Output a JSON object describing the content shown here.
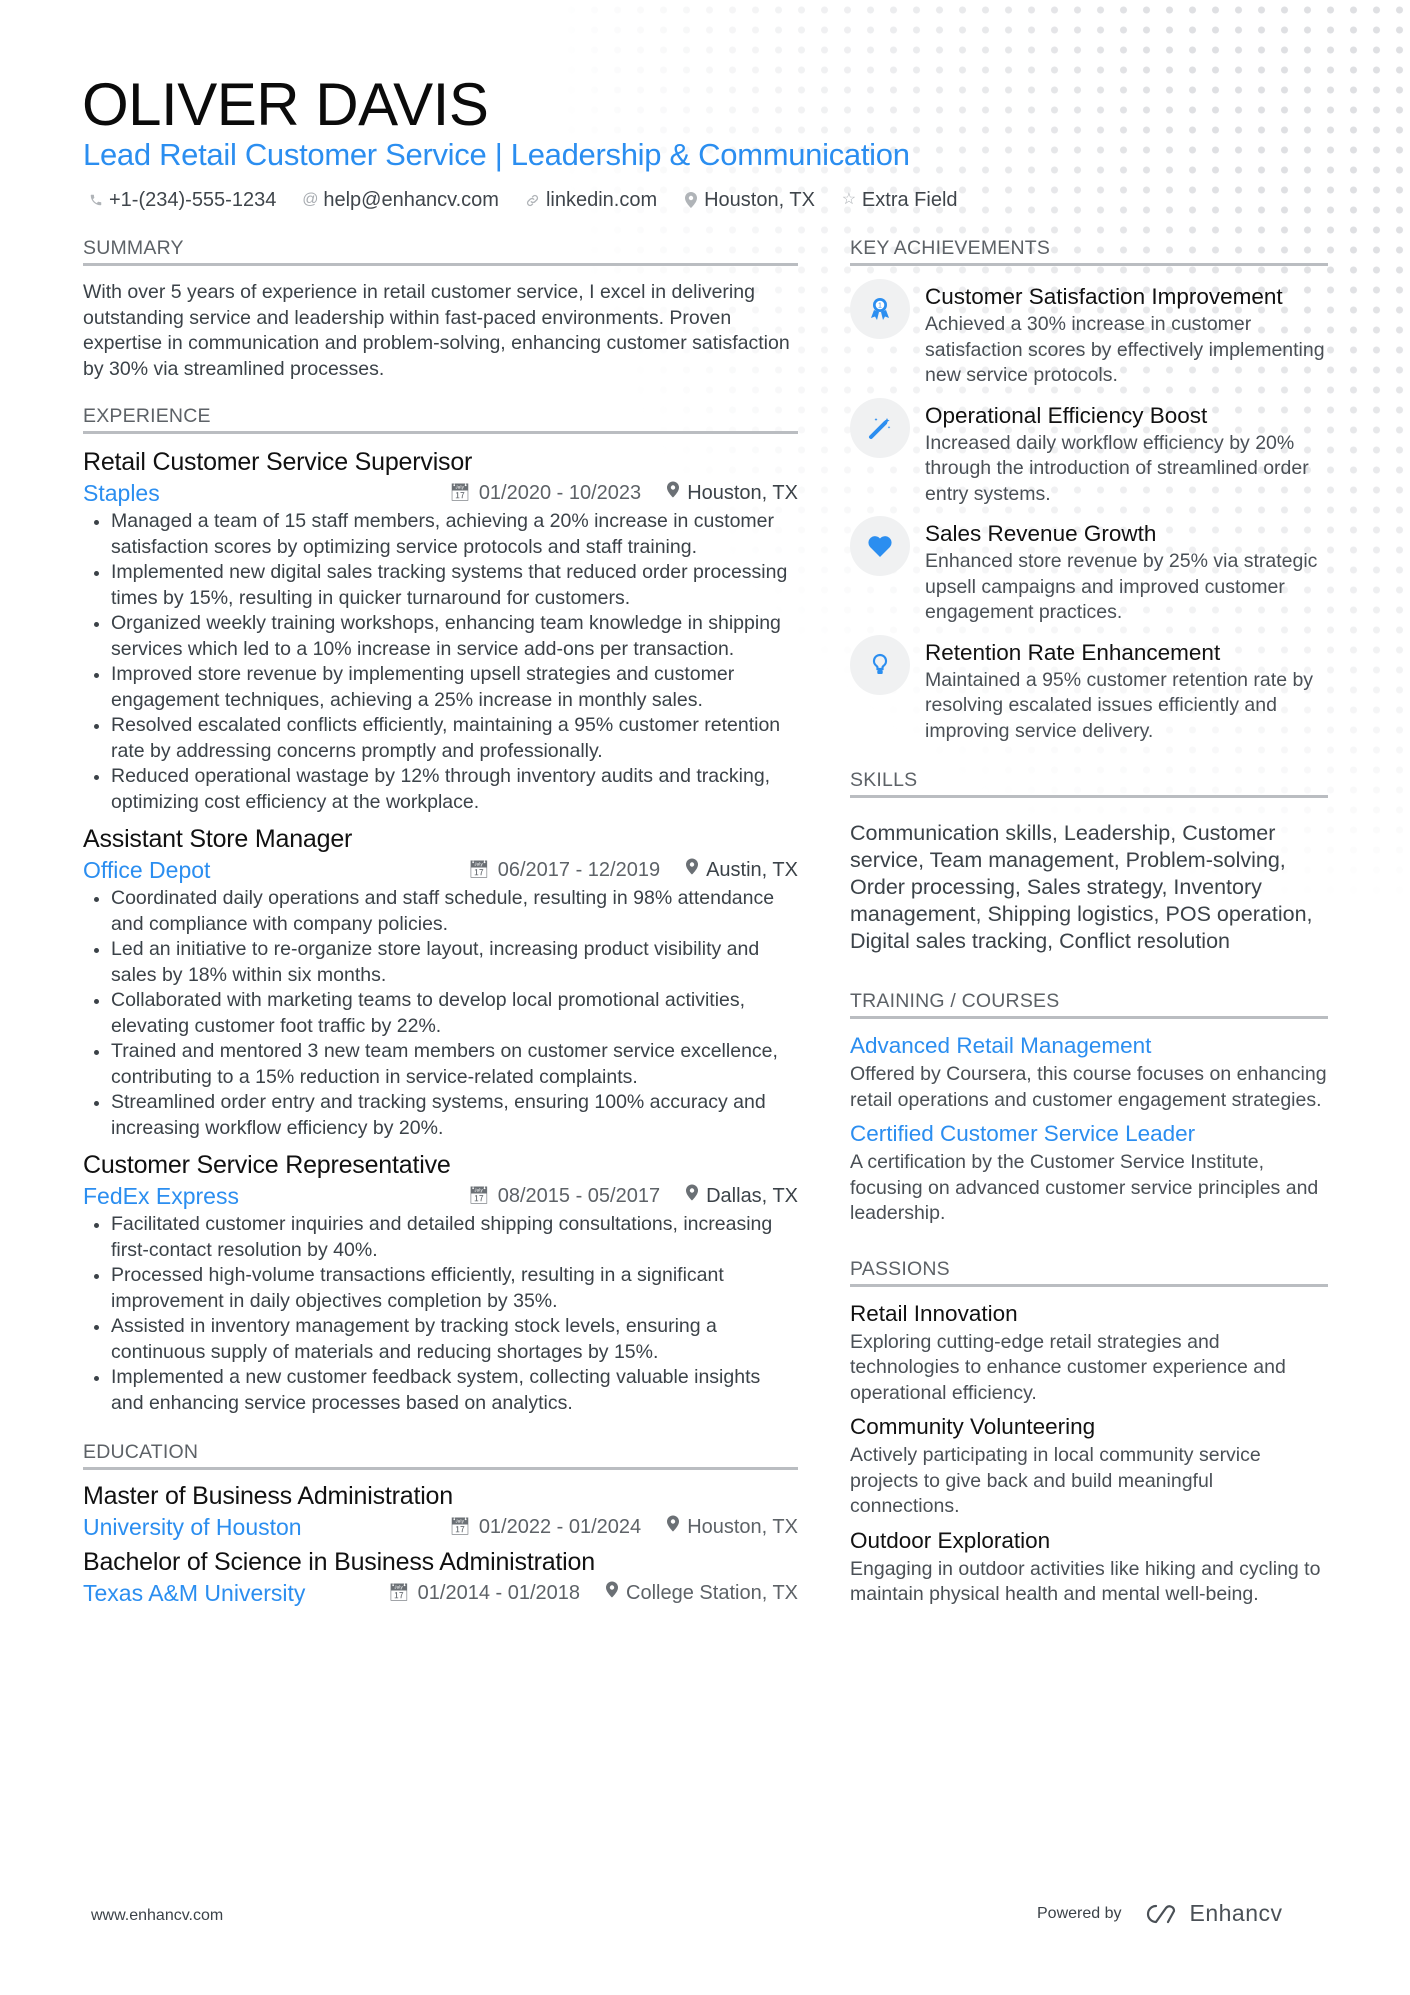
{
  "header": {
    "name": "OLIVER DAVIS",
    "headline": "Lead Retail Customer Service | Leadership & Communication",
    "contacts": [
      {
        "icon": "phone-icon",
        "text": "+1-(234)-555-1234"
      },
      {
        "icon": "at-icon",
        "text": "help@enhancv.com"
      },
      {
        "icon": "link-icon",
        "text": "linkedin.com"
      },
      {
        "icon": "map-pin-icon",
        "text": "Houston, TX"
      },
      {
        "icon": "star-icon",
        "text": "Extra Field"
      }
    ]
  },
  "summary": {
    "heading": "SUMMARY",
    "text": "With over 5 years of experience in retail customer service, I excel in delivering outstanding service and leadership within fast-paced environments. Proven expertise in communication and problem-solving, enhancing customer satisfaction by 30% via streamlined processes."
  },
  "experience": {
    "heading": "EXPERIENCE",
    "jobs": [
      {
        "title": "Retail Customer Service Supervisor",
        "company": "Staples",
        "dates": "01/2020 - 10/2023",
        "location": "Houston, TX",
        "bullets": [
          "Managed a team of 15 staff members, achieving a 20% increase in customer satisfaction scores by optimizing service protocols and staff training.",
          "Implemented new digital sales tracking systems that reduced order processing times by 15%, resulting in quicker turnaround for customers.",
          "Organized weekly training workshops, enhancing team knowledge in shipping services which led to a 10% increase in service add-ons per transaction.",
          "Improved store revenue by implementing upsell strategies and customer engagement techniques, achieving a 25% increase in monthly sales.",
          "Resolved escalated conflicts efficiently, maintaining a 95% customer retention rate by addressing concerns promptly and professionally.",
          "Reduced operational wastage by 12% through inventory audits and tracking, optimizing cost efficiency at the workplace."
        ]
      },
      {
        "title": "Assistant Store Manager",
        "company": "Office Depot",
        "dates": "06/2017 - 12/2019",
        "location": "Austin, TX",
        "bullets": [
          "Coordinated daily operations and staff schedule, resulting in 98% attendance and compliance with company policies.",
          "Led an initiative to re-organize store layout, increasing product visibility and sales by 18% within six months.",
          "Collaborated with marketing teams to develop local promotional activities, elevating customer foot traffic by 22%.",
          "Trained and mentored 3 new team members on customer service excellence, contributing to a 15% reduction in service-related complaints.",
          "Streamlined order entry and tracking systems, ensuring 100% accuracy and increasing workflow efficiency by 20%."
        ]
      },
      {
        "title": "Customer Service Representative",
        "company": "FedEx Express",
        "dates": "08/2015 - 05/2017",
        "location": "Dallas, TX",
        "bullets": [
          "Facilitated customer inquiries and detailed shipping consultations, increasing first-contact resolution by 40%.",
          "Processed high-volume transactions efficiently, resulting in a significant improvement in daily objectives completion by 35%.",
          "Assisted in inventory management by tracking stock levels, ensuring a continuous supply of materials and reducing shortages by 15%.",
          "Implemented a new customer feedback system, collecting valuable insights and enhancing service processes based on analytics."
        ]
      }
    ]
  },
  "education": {
    "heading": "EDUCATION",
    "items": [
      {
        "degree": "Master of Business Administration",
        "school": "University of Houston",
        "dates": "01/2022 - 01/2024",
        "location": "Houston, TX"
      },
      {
        "degree": "Bachelor of Science in Business Administration",
        "school": "Texas A&M University",
        "dates": "01/2014 - 01/2018",
        "location": "College Station, TX"
      }
    ]
  },
  "achievements": {
    "heading": "KEY ACHIEVEMENTS",
    "items": [
      {
        "icon": "award-ribbon-icon",
        "title": "Customer Satisfaction Improvement",
        "desc": "Achieved a 30% increase in customer satisfaction scores by effectively implementing new service protocols."
      },
      {
        "icon": "magic-wand-icon",
        "title": "Operational Efficiency Boost",
        "desc": "Increased daily workflow efficiency by 20% through the introduction of streamlined order entry systems."
      },
      {
        "icon": "heart-icon",
        "title": "Sales Revenue Growth",
        "desc": "Enhanced store revenue by 25% via strategic upsell campaigns and improved customer engagement practices."
      },
      {
        "icon": "lightbulb-icon",
        "title": "Retention Rate Enhancement",
        "desc": "Maintained a 95% customer retention rate by resolving escalated issues efficiently and improving service delivery."
      }
    ]
  },
  "skills": {
    "heading": "SKILLS",
    "text": "Communication skills, Leadership, Customer service, Team management, Problem-solving, Order processing, Sales strategy, Inventory management, Shipping logistics, POS operation, Digital sales tracking, Conflict resolution"
  },
  "training": {
    "heading": "TRAINING / COURSES",
    "items": [
      {
        "title": "Advanced Retail Management",
        "desc": "Offered by Coursera, this course focuses on enhancing retail operations and customer engagement strategies."
      },
      {
        "title": "Certified Customer Service Leader",
        "desc": "A certification by the Customer Service Institute, focusing on advanced customer service principles and leadership."
      }
    ]
  },
  "passions": {
    "heading": "PASSIONS",
    "items": [
      {
        "title": "Retail Innovation",
        "desc": "Exploring cutting-edge retail strategies and technologies to enhance customer experience and operational efficiency."
      },
      {
        "title": "Community Volunteering",
        "desc": "Actively participating in local community service projects to give back and build meaningful connections."
      },
      {
        "title": "Outdoor Exploration",
        "desc": "Engaging in outdoor activities like hiking and cycling to maintain physical health and mental well-being."
      }
    ]
  },
  "footer": {
    "website": "www.enhancv.com",
    "powered_by": "Powered by",
    "brand": "Enhancv"
  },
  "colors": {
    "accent": "#2b8ef0",
    "text": "#3b4248",
    "heading_gray": "#5d6267",
    "rule": "#babdc1",
    "icon_bg": "#f0f1f2"
  }
}
